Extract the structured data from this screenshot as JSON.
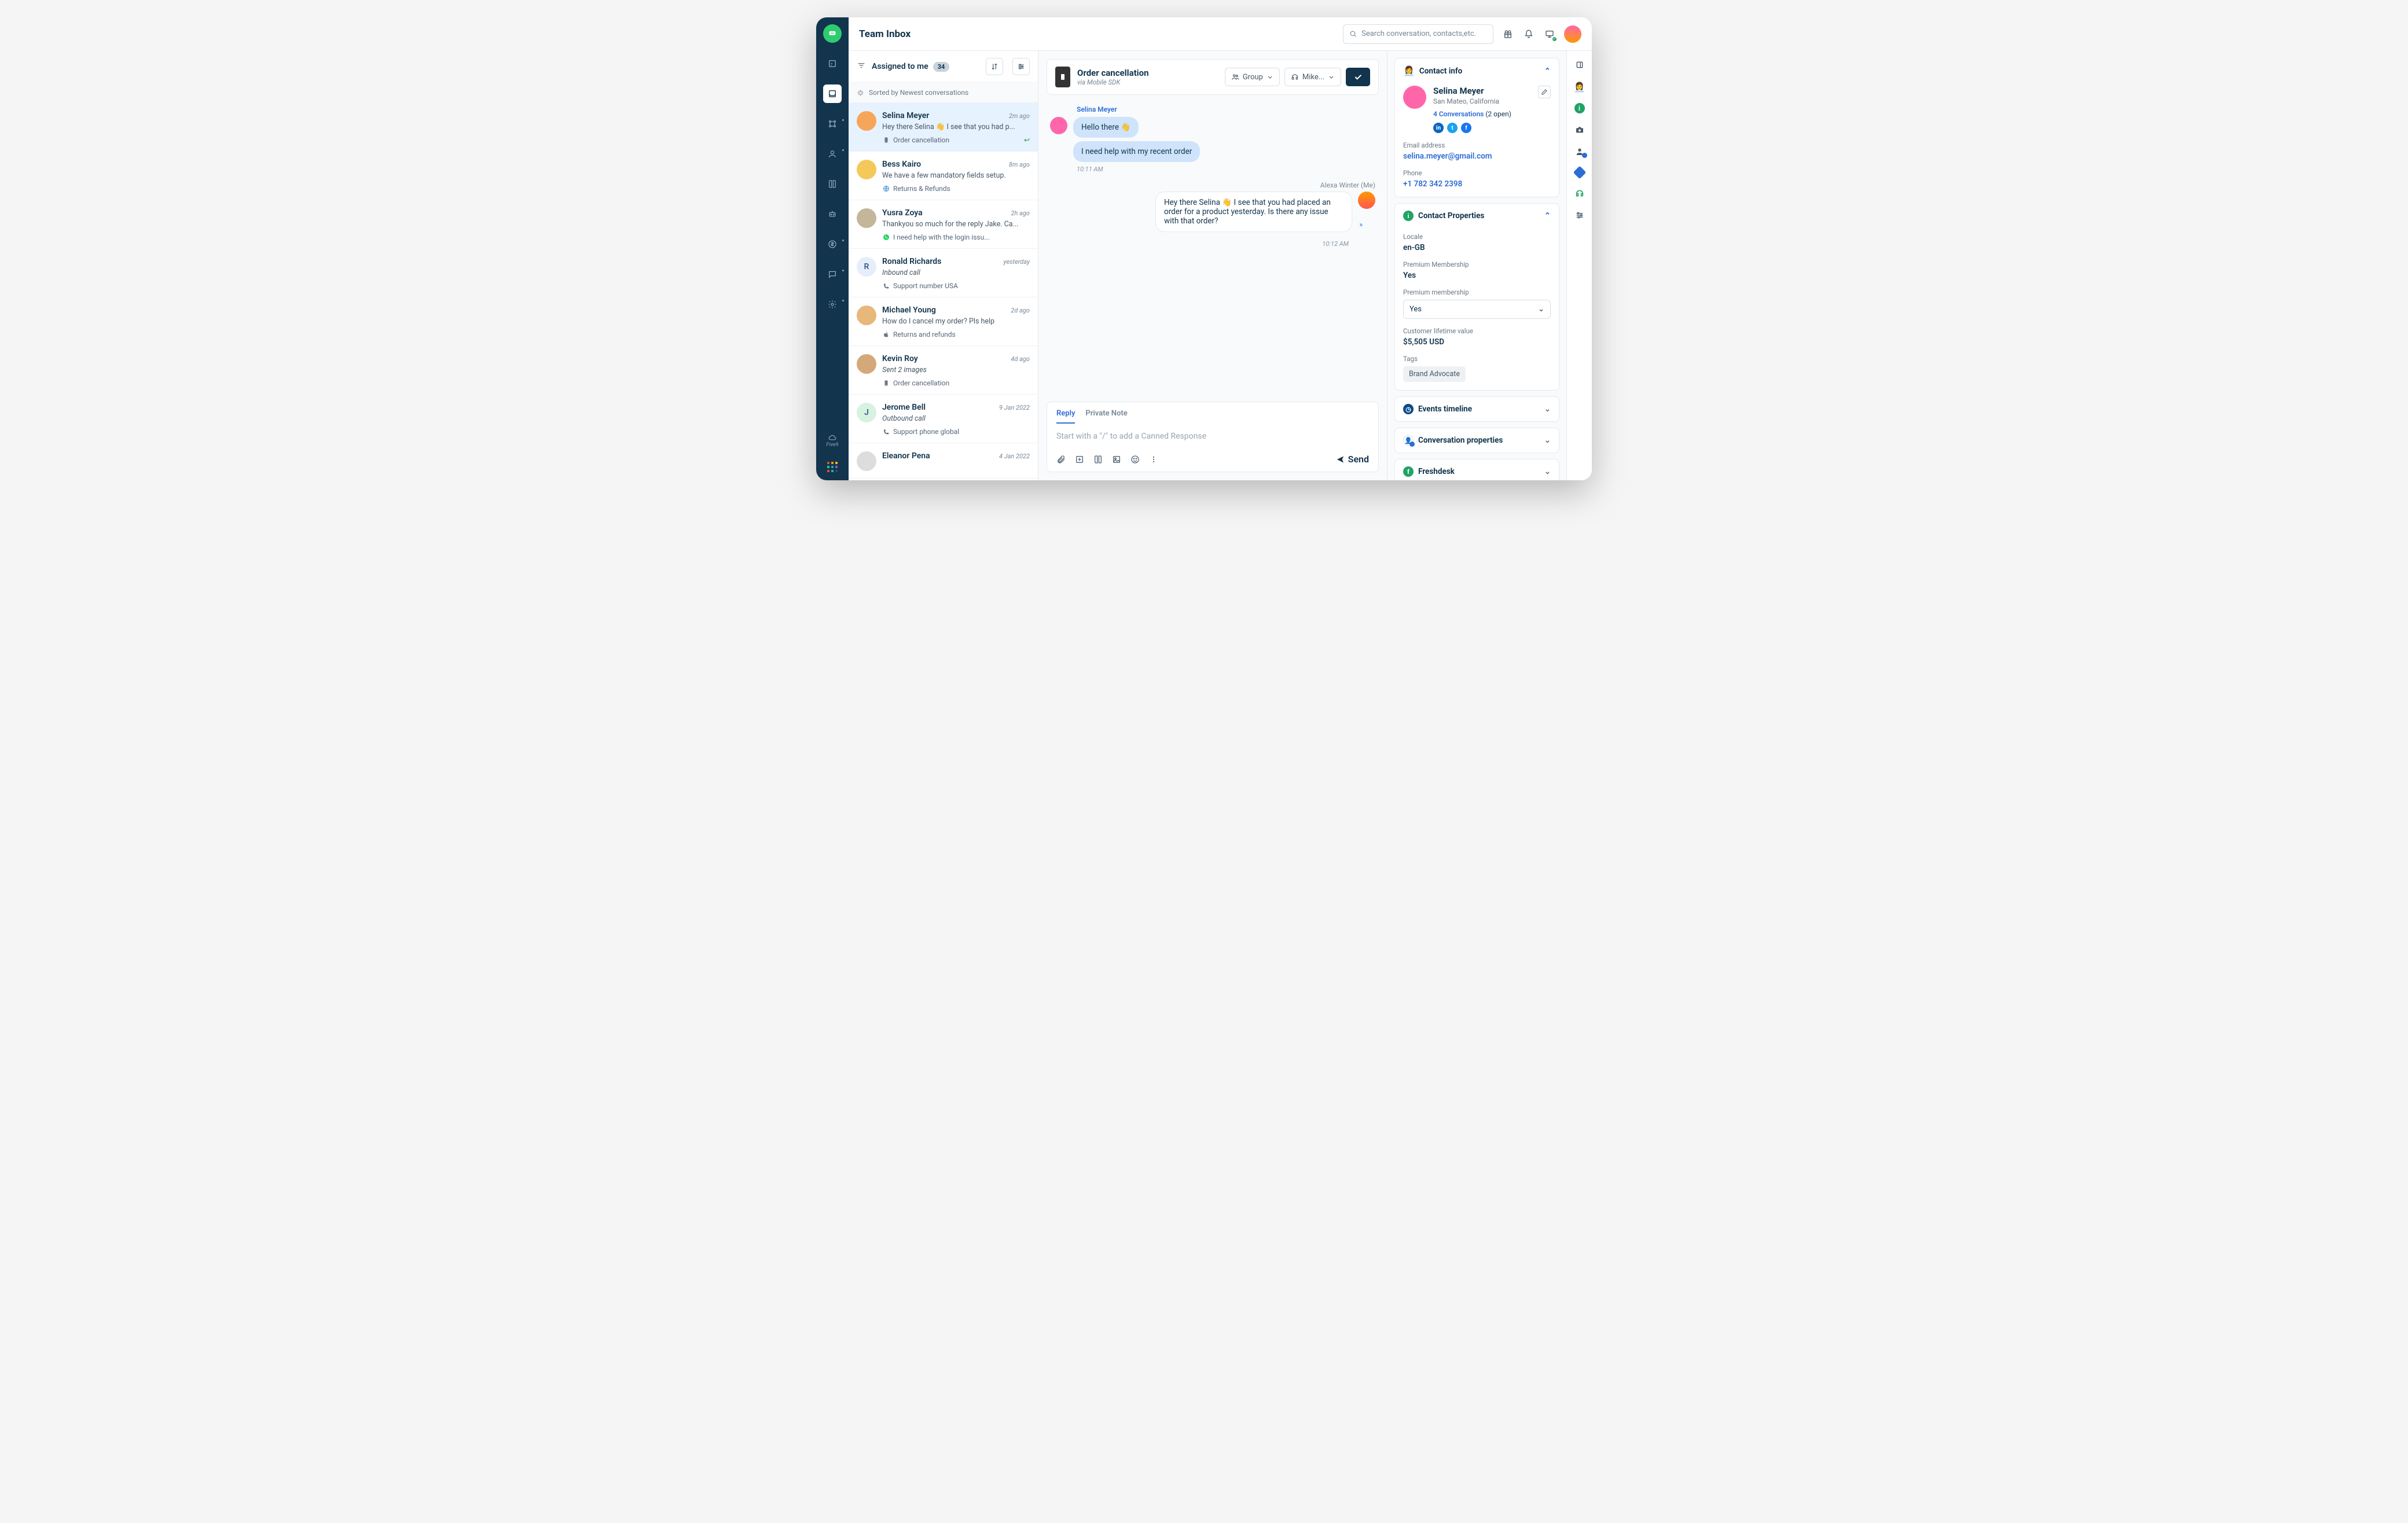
{
  "header": {
    "title": "Team Inbox",
    "search_placeholder": "Search conversation, contacts,etc."
  },
  "list": {
    "filter_label": "Assigned to me",
    "filter_count": "34",
    "sort_label": "Sorted by Newest conversations"
  },
  "conversations": [
    {
      "name": "Selina Meyer",
      "time": "2m ago",
      "preview": "Hey there Selina 👋 I see that you had p...",
      "channel_icon": "mobile-icon",
      "channel": "Order cancellation",
      "active": true,
      "reply": true,
      "avatar": "#f6a65a"
    },
    {
      "name": "Bess Kairo",
      "time": "8m ago",
      "preview": "We have a few mandatory fields setup.",
      "channel_icon": "globe-icon",
      "channel": "Returns & Refunds",
      "avatar": "#f5c85a"
    },
    {
      "name": "Yusra Zoya",
      "time": "2h ago",
      "preview": "Thankyou so much for the reply Jake. Ca...",
      "channel_icon": "whatsapp-icon",
      "channel": "I need help with the login issu...",
      "avatar": "#c4b69a"
    },
    {
      "name": "Ronald Richards",
      "time": "yesterday",
      "preview": "Inbound call",
      "preview_italic": true,
      "channel_icon": "phone-icon",
      "channel": "Support number USA",
      "avatar_letter": "R",
      "avatar": "#e6eefc"
    },
    {
      "name": "Michael Young",
      "time": "2d ago",
      "preview": "How do I cancel my order? Pls help",
      "channel_icon": "apple-icon",
      "channel": "Returns and refunds",
      "avatar": "#e8b77a"
    },
    {
      "name": "Kevin Roy",
      "time": "4d ago",
      "preview": "Sent 2 images",
      "preview_italic": true,
      "channel_icon": "mobile-icon",
      "channel": "Order cancellation",
      "avatar": "#d4a97a"
    },
    {
      "name": "Jerome Bell",
      "time": "9 Jan 2022",
      "preview": "Outbound call",
      "preview_italic": true,
      "channel_icon": "phone-icon",
      "channel": "Support phone global",
      "avatar_letter": "J",
      "avatar": "#d6f2e1"
    },
    {
      "name": "Eleanor Pena",
      "time": "4 Jan 2022",
      "preview": "",
      "channel": "",
      "avatar": "#ddd"
    }
  ],
  "thread": {
    "title": "Order cancellation",
    "subtitle": "via Mobile SDK",
    "group_label": "Group",
    "agent_label": "Mike...",
    "sender": "Selina Meyer",
    "agent_name": "Alexa Winter (Me)",
    "messages_in": [
      "Hello there 👋",
      "I need help with my recent order"
    ],
    "ts_in": "10:11 AM",
    "message_out": "Hey there Selina 👋 I see that you had placed an order for a product yesterday. Is there any issue with that order?",
    "ts_out": "10:12 AM"
  },
  "composer": {
    "tab_reply": "Reply",
    "tab_note": "Private Note",
    "placeholder": "Start with a \"/\" to add a Canned Response",
    "send_label": "Send"
  },
  "contact": {
    "panel_title": "Contact info",
    "name": "Selina Meyer",
    "location": "San Mateo, California",
    "conv_count_label": "4 Conversations",
    "conv_open": "(2 open)",
    "email_label": "Email address",
    "email": "selina.meyer@gmail.com",
    "phone_label": "Phone",
    "phone": "+1 782 342 2398",
    "props_title": "Contact Properties",
    "locale_label": "Locale",
    "locale": "en-GB",
    "premium_label": "Premium Membership",
    "premium": "Yes",
    "premium_select_label": "Premium membership",
    "premium_select_value": "Yes",
    "clv_label": "Customer lifetime value",
    "clv": "$5,505 USD",
    "tags_label": "Tags",
    "tag": "Brand Advocate",
    "events_title": "Events timeline",
    "convprops_title": "Conversation properties",
    "freshdesk_title": "Freshdesk"
  }
}
